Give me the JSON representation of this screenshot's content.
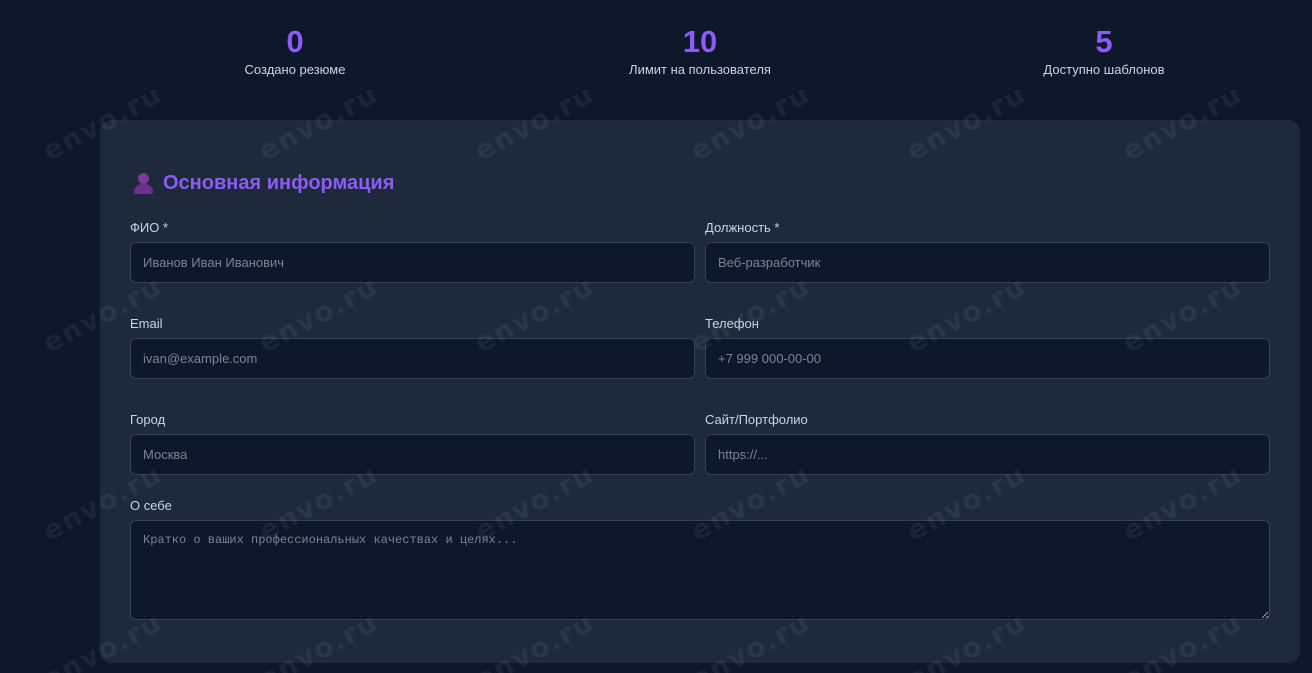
{
  "stats": [
    {
      "value": "0",
      "label": "Создано резюме"
    },
    {
      "value": "10",
      "label": "Лимит на пользователя"
    },
    {
      "value": "5",
      "label": "Доступно шаблонов"
    }
  ],
  "watermark": "envo.ru",
  "colors": {
    "background": "#0f172a",
    "card": "#1e293b",
    "accent": "#8b5cf6",
    "input_bg": "#0f172a",
    "input_border": "#334155"
  },
  "section": {
    "icon": "person-icon",
    "title": "Основная информация"
  },
  "form": {
    "full_name": {
      "label": "ФИО *",
      "placeholder": "Иванов Иван Иванович",
      "value": ""
    },
    "position": {
      "label": "Должность *",
      "placeholder": "Веб-разработчик",
      "value": ""
    },
    "email": {
      "label": "Email",
      "placeholder": "ivan@example.com",
      "value": ""
    },
    "phone": {
      "label": "Телефон",
      "placeholder": "+7 999 000-00-00",
      "value": ""
    },
    "city": {
      "label": "Город",
      "placeholder": "Москва",
      "value": ""
    },
    "website": {
      "label": "Сайт/Портфолио",
      "placeholder": "https://...",
      "value": ""
    },
    "about": {
      "label": "О себе",
      "placeholder": "Кратко о ваших профессиональных качествах и целях...",
      "value": ""
    }
  }
}
